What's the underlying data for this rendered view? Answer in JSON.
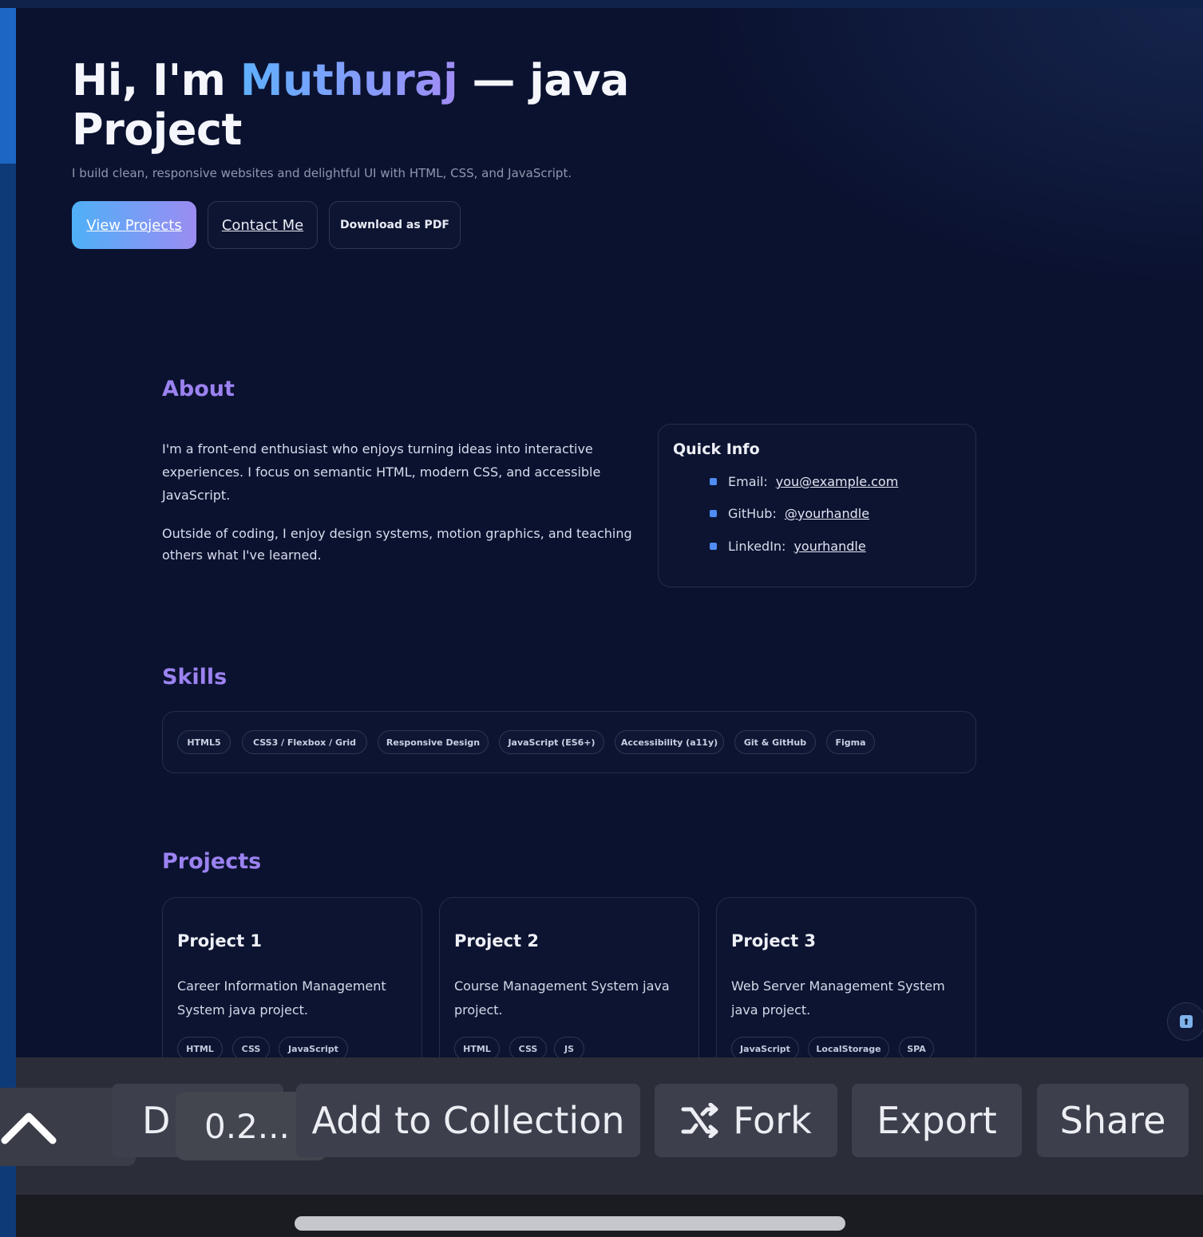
{
  "hero": {
    "title_prefix": "Hi, I'm ",
    "title_name": "Muthuraj",
    "title_suffix_line1": " — java",
    "title_line2": "Project",
    "subtitle": "I build clean, responsive websites and delightful UI with HTML, CSS, and JavaScript.",
    "buttons": {
      "view_projects": "View Projects",
      "contact": "Contact Me",
      "download_pdf": "Download as PDF"
    }
  },
  "about": {
    "heading": "About",
    "paragraph1": "I'm a front-end enthusiast who enjoys turning ideas into interactive experiences. I focus on semantic HTML, modern CSS, and accessible JavaScript.",
    "paragraph2": "Outside of coding, I enjoy design systems, motion graphics, and teaching others what I've learned.",
    "quick_info": {
      "title": "Quick Info",
      "items": [
        {
          "label": "Email:",
          "value": "you@example.com"
        },
        {
          "label": "GitHub:",
          "value": "@yourhandle"
        },
        {
          "label": "LinkedIn:",
          "value": "yourhandle"
        }
      ]
    }
  },
  "skills": {
    "heading": "Skills",
    "chips": [
      "HTML5",
      "CSS3 / Flexbox / Grid",
      "Responsive Design",
      "JavaScript (ES6+)",
      "Accessibility (a11y)",
      "Git & GitHub",
      "Figma"
    ]
  },
  "projects": {
    "heading": "Projects",
    "items": [
      {
        "title": "Project 1",
        "description": "Career Information Management System java project.",
        "tags": [
          "HTML",
          "CSS",
          "JavaScript"
        ]
      },
      {
        "title": "Project 2",
        "description": "Course Management System java project.",
        "tags": [
          "HTML",
          "CSS",
          "JS"
        ]
      },
      {
        "title": "Project 3",
        "description": "Web Server Management System java project.",
        "tags": [
          "JavaScript",
          "LocalStorage",
          "SPA"
        ]
      }
    ]
  },
  "back_to_top": {
    "glyph": "⬆"
  },
  "toolbar": {
    "d_label": "D",
    "version": "0.2...",
    "add_to_collection": "Add to Collection",
    "fork": "Fork",
    "export": "Export",
    "share": "Share",
    "icons": {
      "collapse": "chevron-up-icon",
      "fork": "fork-icon"
    }
  },
  "colors": {
    "background": "#0b1230",
    "accent_purple": "#9b82f0",
    "accent_blue": "#5fb0ff",
    "toolbar": "#2b2e38"
  }
}
